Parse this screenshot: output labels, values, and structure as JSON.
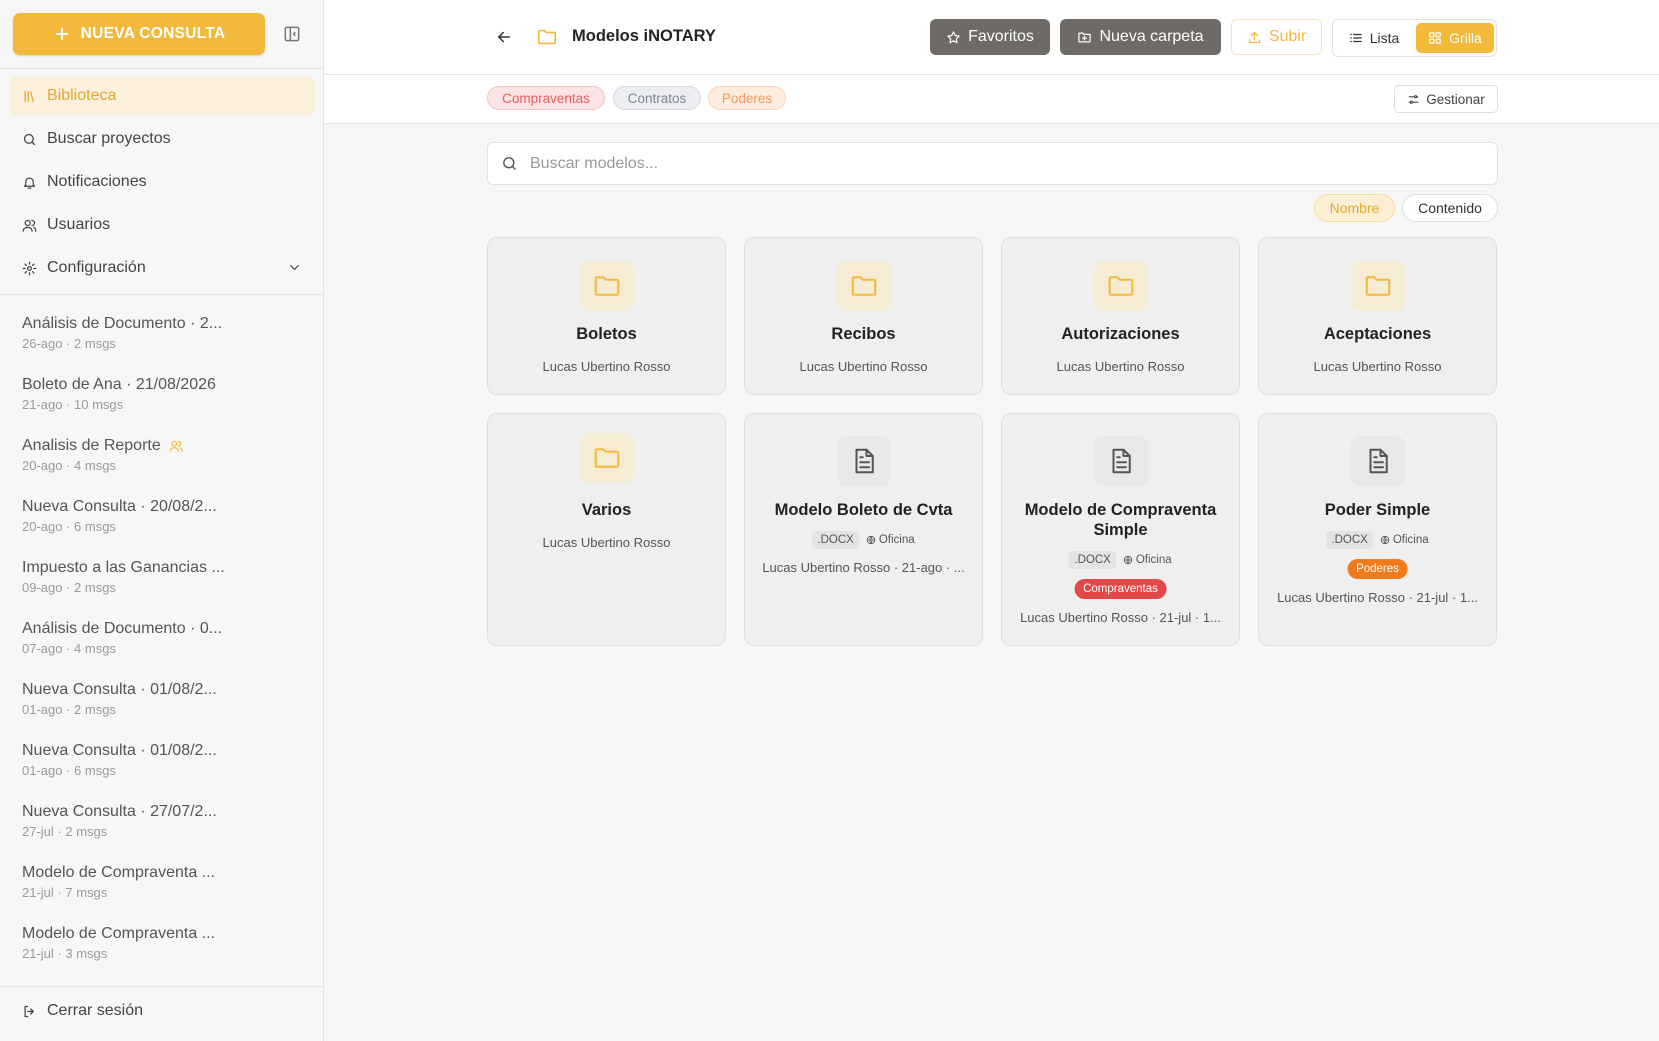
{
  "sidebar": {
    "new_button": "NUEVA CONSULTA",
    "nav": [
      {
        "label": "Biblioteca",
        "icon": "library-icon"
      },
      {
        "label": "Buscar proyectos",
        "icon": "search-icon"
      },
      {
        "label": "Notificaciones",
        "icon": "bell-icon"
      },
      {
        "label": "Usuarios",
        "icon": "users-icon"
      },
      {
        "label": "Configuración",
        "icon": "gear-icon"
      }
    ],
    "history": [
      {
        "title": "Análisis de Documento · 2...",
        "meta": "26-ago · 2 msgs"
      },
      {
        "title": "Boleto de Ana · 21/08/2026",
        "meta": "21-ago · 10 msgs"
      },
      {
        "title": "Analisis de Reporte",
        "meta": "20-ago · 4 msgs",
        "shared": true
      },
      {
        "title": "Nueva Consulta · 20/08/2...",
        "meta": "20-ago · 6 msgs"
      },
      {
        "title": "Impuesto a las Ganancias ...",
        "meta": "09-ago · 2 msgs"
      },
      {
        "title": "Análisis de Documento · 0...",
        "meta": "07-ago · 4 msgs"
      },
      {
        "title": "Nueva Consulta · 01/08/2...",
        "meta": "01-ago · 2 msgs"
      },
      {
        "title": "Nueva Consulta · 01/08/2...",
        "meta": "01-ago · 6 msgs"
      },
      {
        "title": "Nueva Consulta · 27/07/2...",
        "meta": "27-jul · 2 msgs"
      },
      {
        "title": "Modelo de Compraventa ...",
        "meta": "21-jul · 7 msgs"
      },
      {
        "title": "Modelo de Compraventa ...",
        "meta": "21-jul · 3 msgs"
      }
    ],
    "logout": "Cerrar sesión"
  },
  "header": {
    "title": "Modelos iNOTARY",
    "favorites": "Favoritos",
    "new_folder": "Nueva carpeta",
    "upload": "Subir",
    "view_list": "Lista",
    "view_grid": "Grilla"
  },
  "tags": {
    "items": [
      {
        "label": "Compraventas",
        "color": "#e85c5c"
      },
      {
        "label": "Contratos",
        "color": "#7d8593"
      },
      {
        "label": "Poderes",
        "color": "#f59a5a"
      }
    ],
    "manage": "Gestionar"
  },
  "search": {
    "placeholder": "Buscar modelos..."
  },
  "filter": {
    "name": "Nombre",
    "content": "Contenido",
    "active": "Nombre"
  },
  "cards": [
    {
      "type": "folder",
      "name": "Boletos",
      "owner": "Lucas Ubertino Rosso"
    },
    {
      "type": "folder",
      "name": "Recibos",
      "owner": "Lucas Ubertino Rosso"
    },
    {
      "type": "folder",
      "name": "Autorizaciones",
      "owner": "Lucas Ubertino Rosso"
    },
    {
      "type": "folder",
      "name": "Aceptaciones",
      "owner": "Lucas Ubertino Rosso"
    },
    {
      "type": "folder",
      "name": "Varios",
      "owner": "Lucas Ubertino Rosso"
    },
    {
      "type": "doc",
      "name": "Modelo Boleto de Cvta",
      "ext": ".DOCX",
      "scope": "Oficina",
      "footer": "Lucas Ubertino Rosso · 21-ago · ..."
    },
    {
      "type": "doc",
      "name": "Modelo de Compraventa Simple",
      "ext": ".DOCX",
      "scope": "Oficina",
      "tag": "Compraventas",
      "tag_color": "#e34848",
      "footer": "Lucas Ubertino Rosso · 21-jul · 1..."
    },
    {
      "type": "doc",
      "name": "Poder Simple",
      "ext": ".DOCX",
      "scope": "Oficina",
      "tag": "Poderes",
      "tag_color": "#f07a1c",
      "footer": "Lucas Ubertino Rosso · 21-jul · 1..."
    }
  ],
  "colors": {
    "accent": "#f2b93b",
    "dark_button": "#6e6a65"
  }
}
